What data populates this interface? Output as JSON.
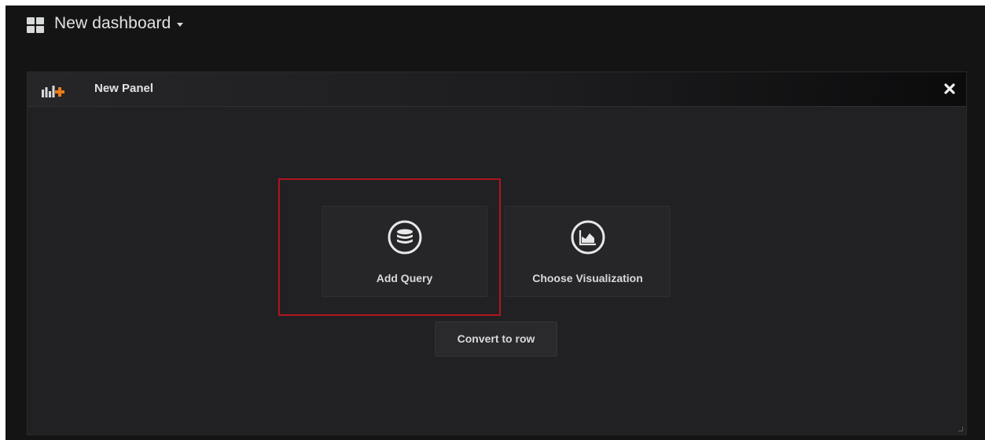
{
  "topnav": {
    "dashboard_icon": "dashboard-grid-icon",
    "title": "New dashboard",
    "dropdown_icon": "caret-down-icon"
  },
  "panel": {
    "icon": "add-panel-icon",
    "title": "New Panel",
    "close_icon": "close-icon",
    "actions": {
      "add_query": {
        "label": "Add Query",
        "icon": "database-icon"
      },
      "choose_visualization": {
        "label": "Choose Visualization",
        "icon": "area-chart-icon"
      },
      "convert_to_row": {
        "label": "Convert to row"
      }
    }
  },
  "colors": {
    "background": "#141414",
    "panel_bg": "#212124",
    "button_bg": "#262628",
    "text": "#d8d9da",
    "accent_orange": "#eb7b18",
    "highlight_red": "#b0141e"
  }
}
